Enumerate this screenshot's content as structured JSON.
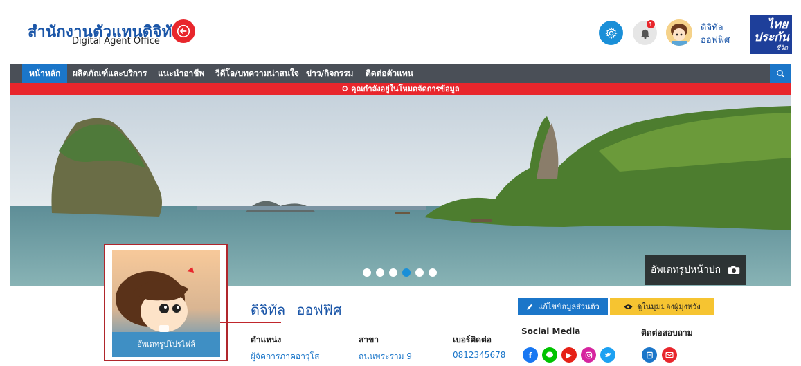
{
  "header": {
    "logo_th": "สำนักงานตัวแทนดิจิทัล",
    "logo_en": "Digital Agent Office",
    "user_first": "ดิจิทัล",
    "user_last": "ออฟฟิศ",
    "notification_count": "1",
    "brand_line1": "ไทย",
    "brand_line2": "ประกัน",
    "brand_line3": "ชีวิต"
  },
  "nav": {
    "items": [
      {
        "label": "หน้าหลัก"
      },
      {
        "label": "ผลิตภัณฑ์และบริการ"
      },
      {
        "label": "แนะนำอาชีพ"
      },
      {
        "label": "วีดีโอ/บทความน่าสนใจ"
      },
      {
        "label": "ข่าว/กิจกรรม"
      },
      {
        "label": "ติดต่อตัวแทน"
      }
    ]
  },
  "notice": "คุณกำลังอยู่ในโหมดจัดการข้อมูล",
  "banner": {
    "update_cover_label": "อัพเดทรูปหน้าปก",
    "slide_count": 6,
    "active_slide": 4
  },
  "profile": {
    "update_photo_label": "อัพเดทรูปโปรไฟล์",
    "first_name": "ดิจิทัล",
    "last_name": "ออฟฟิศ",
    "position_label": "ตำแหน่ง",
    "position_value": "ผู้จัดการภาคอาวุโส",
    "branch_label": "สาขา",
    "branch_value": "ถนนพระราม 9",
    "phone_label": "เบอร์ติดต่อ",
    "phone_value": "0812345678"
  },
  "actions": {
    "edit_label": "แก้ไขข้อมูลส่วนตัว",
    "view_label": "ดูในมุมมองผู้มุ่งหวัง"
  },
  "social": {
    "label": "Social Media",
    "contact_label": "ติดต่อสอบถาม",
    "colors": {
      "facebook": "#1877f2",
      "line": "#00c300",
      "youtube": "#e62117",
      "instagram": "#d6249f",
      "twitter": "#1da1f2",
      "message": "#1b76c9",
      "email": "#e8262c"
    }
  },
  "colors": {
    "primary": "#1b56a8",
    "accent_blue": "#1b76c9",
    "nav_bg": "#4a4f57",
    "notice_red": "#e8262c",
    "yellow": "#f6c431"
  }
}
